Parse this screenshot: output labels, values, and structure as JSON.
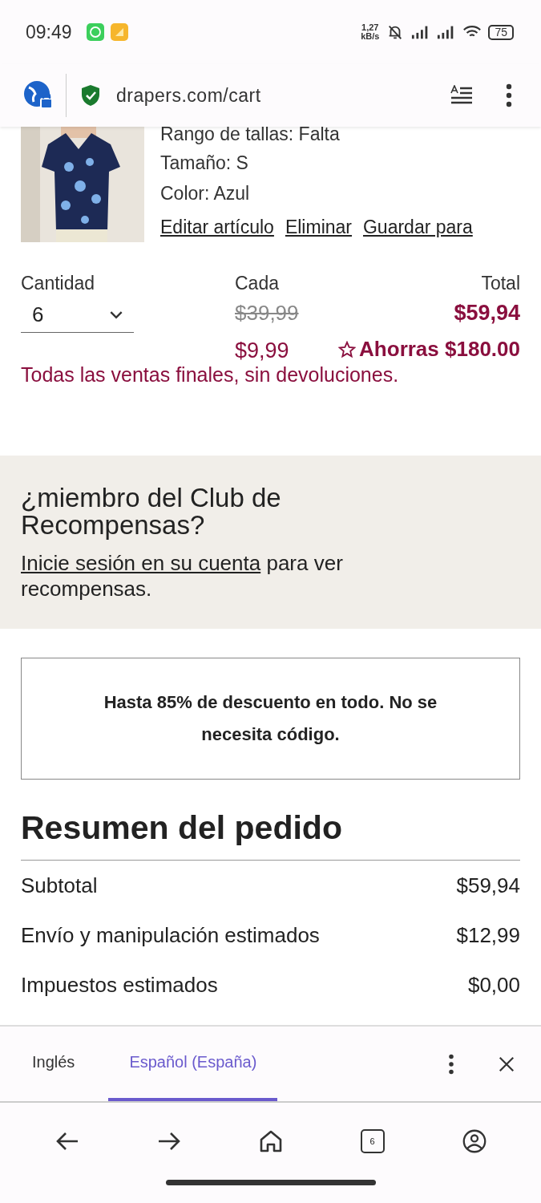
{
  "status_bar": {
    "time": "09:49",
    "net_speed": "1,27",
    "net_unit": "kB/s",
    "battery": "75"
  },
  "browser": {
    "url": "drapers.com/cart"
  },
  "product": {
    "details": [
      "Rango de tallas: Falta",
      "Tamaño: S",
      "Color: Azul"
    ],
    "links": [
      "Editar artículo",
      "Eliminar",
      "Guardar para"
    ]
  },
  "quantity": {
    "label": "Cantidad",
    "value": "6"
  },
  "each": {
    "label": "Cada",
    "original_price": "$39,99",
    "price": "$9,99"
  },
  "total": {
    "label": "Total",
    "price": "$59,94",
    "savings": "Ahorras $180.00"
  },
  "final_sale_note": "Todas las ventas finales, sin devoluciones.",
  "rewards": {
    "title": "¿miembro del Club de Recompensas?",
    "link": "Inicie sesión en su cuenta",
    "text": " para ver recompensas."
  },
  "promo": "Hasta 85% de descuento en todo. No se necesita código.",
  "summary": {
    "title": "Resumen del pedido",
    "rows": [
      {
        "label": "Subtotal",
        "value": "$59,94"
      },
      {
        "label": "Envío y manipulación estimados",
        "value": "$12,99"
      },
      {
        "label": "Impuestos estimados",
        "value": "$0,00"
      }
    ]
  },
  "translate_bar": {
    "tabs": [
      {
        "label": "Inglés",
        "selected": false
      },
      {
        "label": "Español (España)",
        "selected": true
      }
    ]
  },
  "nav_bar": {
    "tab_count": "6"
  }
}
